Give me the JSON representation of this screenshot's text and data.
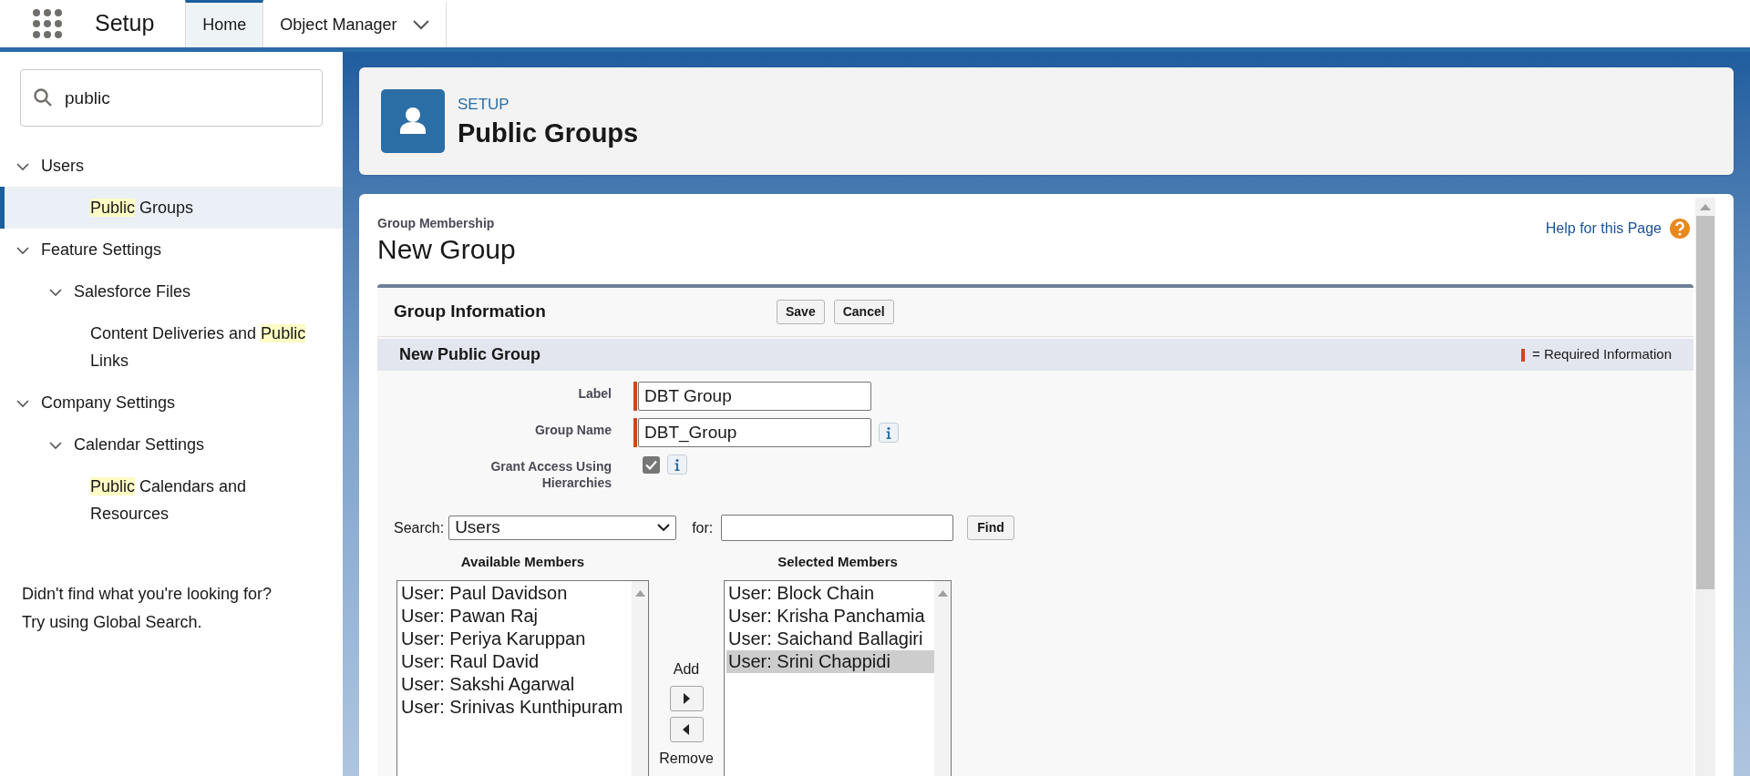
{
  "app_bar": {
    "app_name": "Setup",
    "tabs": [
      {
        "label": "Home",
        "selected": true,
        "has_menu": false
      },
      {
        "label": "Object Manager",
        "selected": false,
        "has_menu": true
      }
    ]
  },
  "sidebar": {
    "search": {
      "value": "public"
    },
    "tree": [
      {
        "parts": [
          {
            "text": "Users",
            "highlighted": false
          }
        ],
        "expanded": true,
        "selected": false,
        "children": [
          {
            "parts": [
              {
                "text": "Public",
                "highlighted": true
              },
              {
                "text": " Groups",
                "highlighted": false
              }
            ],
            "selected": true
          }
        ]
      },
      {
        "parts": [
          {
            "text": "Feature Settings",
            "highlighted": false
          }
        ],
        "expanded": true,
        "selected": false,
        "children": [
          {
            "parts": [
              {
                "text": "Salesforce Files",
                "highlighted": false
              }
            ],
            "expanded": true,
            "selected": false,
            "children": [
              {
                "parts": [
                  {
                    "text": "Content Deliveries and ",
                    "highlighted": false
                  },
                  {
                    "text": "Public",
                    "highlighted": true
                  },
                  {
                    "text": " Links",
                    "highlighted": false
                  }
                ],
                "selected": false
              }
            ]
          }
        ]
      },
      {
        "parts": [
          {
            "text": "Company Settings",
            "highlighted": false
          }
        ],
        "expanded": true,
        "selected": false,
        "children": [
          {
            "parts": [
              {
                "text": "Calendar Settings",
                "highlighted": false
              }
            ],
            "expanded": true,
            "selected": false,
            "children": [
              {
                "parts": [
                  {
                    "text": "Public",
                    "highlighted": true
                  },
                  {
                    "text": " Calendars and Resources",
                    "highlighted": false
                  }
                ],
                "selected": false
              }
            ]
          }
        ]
      }
    ],
    "footer": [
      "Didn't find what you're looking for?",
      "Try using Global Search."
    ]
  },
  "header": {
    "eyebrow": "SETUP",
    "title": "Public Groups"
  },
  "page": {
    "breadcrumb": "Group Membership",
    "title": "New Group",
    "help_link": "Help for this Page"
  },
  "block": {
    "title": "Group Information",
    "buttons": [
      "Save",
      "Cancel"
    ],
    "section": {
      "title": "New Public Group",
      "legend": "= Required Information"
    },
    "fields": [
      {
        "kind": "text",
        "label": "Label",
        "value": "DBT Group",
        "required": true,
        "info": false
      },
      {
        "kind": "text",
        "label": "Group Name",
        "value": "DBT_Group",
        "required": true,
        "info": true
      },
      {
        "kind": "checkbox",
        "label": "Grant Access Using Hierarchies",
        "checked": true,
        "info": true
      }
    ]
  },
  "member_search": {
    "label": "Search:",
    "type": "Users",
    "for_label": "for:",
    "button": "Find"
  },
  "available": {
    "title": "Available Members",
    "items": [
      {
        "label": "User: Paul Davidson",
        "selected": false
      },
      {
        "label": "User: Pawan Raj",
        "selected": false
      },
      {
        "label": "User: Periya Karuppan",
        "selected": false
      },
      {
        "label": "User: Raul David",
        "selected": false
      },
      {
        "label": "User: Sakshi Agarwal",
        "selected": false
      },
      {
        "label": "User: Srinivas Kunthipuram",
        "selected": false
      }
    ]
  },
  "mover": {
    "add": "Add",
    "remove": "Remove"
  },
  "selected_members": {
    "title": "Selected Members",
    "items": [
      {
        "label": "User: Block Chain",
        "selected": false
      },
      {
        "label": "User: Krisha Panchamia",
        "selected": false
      },
      {
        "label": "User: Saichand Ballagiri",
        "selected": false
      },
      {
        "label": "User: Srini Chappidi",
        "selected": true
      }
    ]
  }
}
